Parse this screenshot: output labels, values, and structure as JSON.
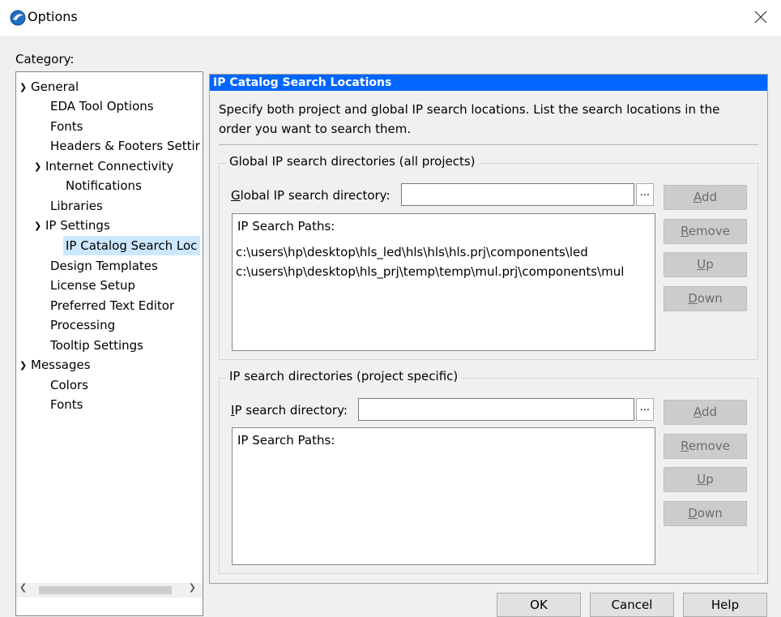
{
  "window": {
    "title": "Options"
  },
  "category_label": "Category:",
  "tree": [
    {
      "label": "General",
      "level": 0,
      "expandable": true
    },
    {
      "label": "EDA Tool Options",
      "level": 1
    },
    {
      "label": "Fonts",
      "level": 1
    },
    {
      "label": "Headers & Footers Settir",
      "level": 1
    },
    {
      "label": "Internet Connectivity",
      "level": 1,
      "expandable": true
    },
    {
      "label": "Notifications",
      "level": 2
    },
    {
      "label": "Libraries",
      "level": 1
    },
    {
      "label": "IP Settings",
      "level": 1,
      "expandable": true
    },
    {
      "label": "IP Catalog Search Loc",
      "level": 2,
      "selected": true
    },
    {
      "label": "Design Templates",
      "level": 1
    },
    {
      "label": "License Setup",
      "level": 1
    },
    {
      "label": "Preferred Text Editor",
      "level": 1
    },
    {
      "label": "Processing",
      "level": 1
    },
    {
      "label": "Tooltip Settings",
      "level": 1
    },
    {
      "label": "Messages",
      "level": 0,
      "expandable": true
    },
    {
      "label": "Colors",
      "level": 1
    },
    {
      "label": "Fonts",
      "level": 1
    }
  ],
  "panel": {
    "header": "IP Catalog Search Locations",
    "description": "Specify both project and global IP search locations. List the search locations in the order you want to search them.",
    "global": {
      "group_title": "Global IP search directories (all projects)",
      "field_label_accel": "G",
      "field_label_rest": "lobal IP search directory:",
      "field_value": "",
      "browse": "...",
      "paths_title": "IP Search Paths:",
      "paths": [
        "c:\\users\\hp\\desktop\\hls_led\\hls\\hls\\hls.prj\\components\\led",
        "c:\\users\\hp\\desktop\\hls_prj\\temp\\temp\\mul.prj\\components\\mul"
      ],
      "buttons": [
        {
          "accel": "A",
          "rest": "dd"
        },
        {
          "accel": "R",
          "rest": "emove"
        },
        {
          "accel": "U",
          "rest": "p"
        },
        {
          "accel": "D",
          "rest": "own"
        }
      ]
    },
    "project": {
      "group_title": "IP search directories (project specific)",
      "field_label_accel": "I",
      "field_label_rest": "P search directory:",
      "field_value": "",
      "browse": "...",
      "paths_title": "IP Search Paths:",
      "paths": [],
      "buttons": [
        {
          "accel": "A",
          "rest": "dd"
        },
        {
          "accel": "R",
          "rest": "emove"
        },
        {
          "accel": "U",
          "rest": "p"
        },
        {
          "accel": "D",
          "rest": "own"
        }
      ]
    }
  },
  "footer": {
    "ok": "OK",
    "cancel": "Cancel",
    "help": "Help"
  }
}
